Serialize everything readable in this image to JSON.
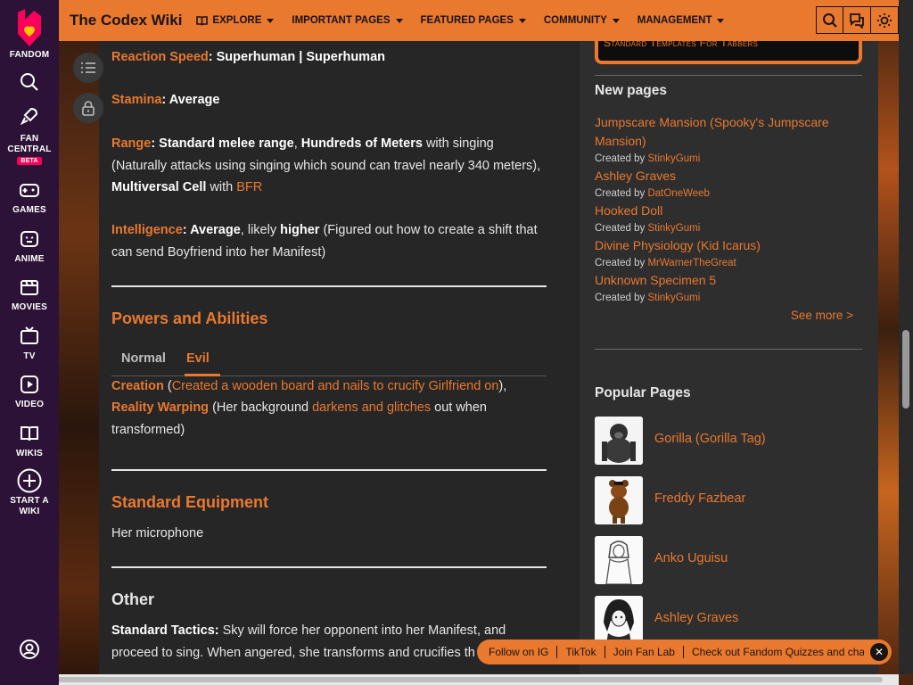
{
  "global_nav": {
    "fandom": "FANDOM",
    "fan_central": "FAN CENTRAL",
    "beta": "BETA",
    "games": "GAMES",
    "anime": "ANIME",
    "movies": "MOVIES",
    "tv": "TV",
    "video": "VIDEO",
    "wikis": "WIKIS",
    "start_wiki": "START A WIKI"
  },
  "header": {
    "wiki_title": "The Codex Wiki",
    "nav": [
      "EXPLORE",
      "IMPORTANT PAGES",
      "FEATURED PAGES",
      "COMMUNITY",
      "MANAGEMENT"
    ]
  },
  "article": {
    "reaction_label": "Reaction Speed",
    "reaction_value": ": Superhuman | Superhuman",
    "stamina_label": "Stamina",
    "stamina_value": ": Average",
    "range_label": "Range",
    "range_p1": ": Standard melee range",
    "range_p2": ", ",
    "range_p3": "Hundreds of Meters",
    "range_p4": " with singing (Naturally attacks using singing which sound can travel nearly 340 meters), ",
    "range_p5": "Multiversal Cell",
    "range_p6": " with ",
    "range_link": "BFR",
    "int_label": "Intelligence",
    "int_p1": ": Average",
    "int_p2": ", likely ",
    "int_p3": "higher",
    "int_p4": " (Figured out how to create a shift that can send Boyfriend into her Manifest)",
    "powers_heading": "Powers and Abilities",
    "tabs": [
      "Normal",
      "Evil"
    ],
    "creation_label": "Creation",
    "creation_p1": " (",
    "creation_link": "Created a wooden board and nails to crucify Girlfriend on",
    "creation_p2": "),",
    "reality_label": "Reality Warping",
    "reality_p1": " (Her background ",
    "reality_link": "darkens and glitches",
    "reality_p2": " out when transformed)",
    "equipment_heading": "Standard Equipment",
    "equipment_text": "Her microphone",
    "other_heading": "Other",
    "tactics_label": "Standard Tactics:",
    "tactics_text": " Sky will force her opponent into her Manifest, and proceed to sing. When angered, she transforms and crucifies th"
  },
  "rail": {
    "templates_link": "Standard Templates For Tabbers",
    "new_pages_heading": "New pages",
    "created_by": "Created by",
    "new_pages": [
      {
        "title": "Jumpscare Mansion (Spooky's Jumpscare Mansion)",
        "user": "StinkyGumi"
      },
      {
        "title": "Ashley Graves",
        "user": "DatOneWeeb"
      },
      {
        "title": "Hooked Doll",
        "user": "StinkyGumi"
      },
      {
        "title": "Divine Physiology (Kid Icarus)",
        "user": "MrWarnerTheGreat"
      },
      {
        "title": "Unknown Specimen 5",
        "user": "StinkyGumi"
      }
    ],
    "see_more": "See more >",
    "popular_heading": "Popular Pages",
    "popular": [
      "Gorilla (Gorilla Tag)",
      "Freddy Fazbear",
      "Anko Uguisu",
      "Ashley Graves"
    ]
  },
  "bottom_bar": {
    "links": [
      "Follow on IG",
      "TikTok",
      "Join Fan Lab",
      "Check out Fandom Quizzes and cha"
    ],
    "close": "✕"
  },
  "colors": {
    "accent": "#e9792f",
    "nav_bg": "#2c1236",
    "content_bg": "#262626",
    "rail_bg": "#2e2e2e",
    "beta": "#fa005a"
  }
}
